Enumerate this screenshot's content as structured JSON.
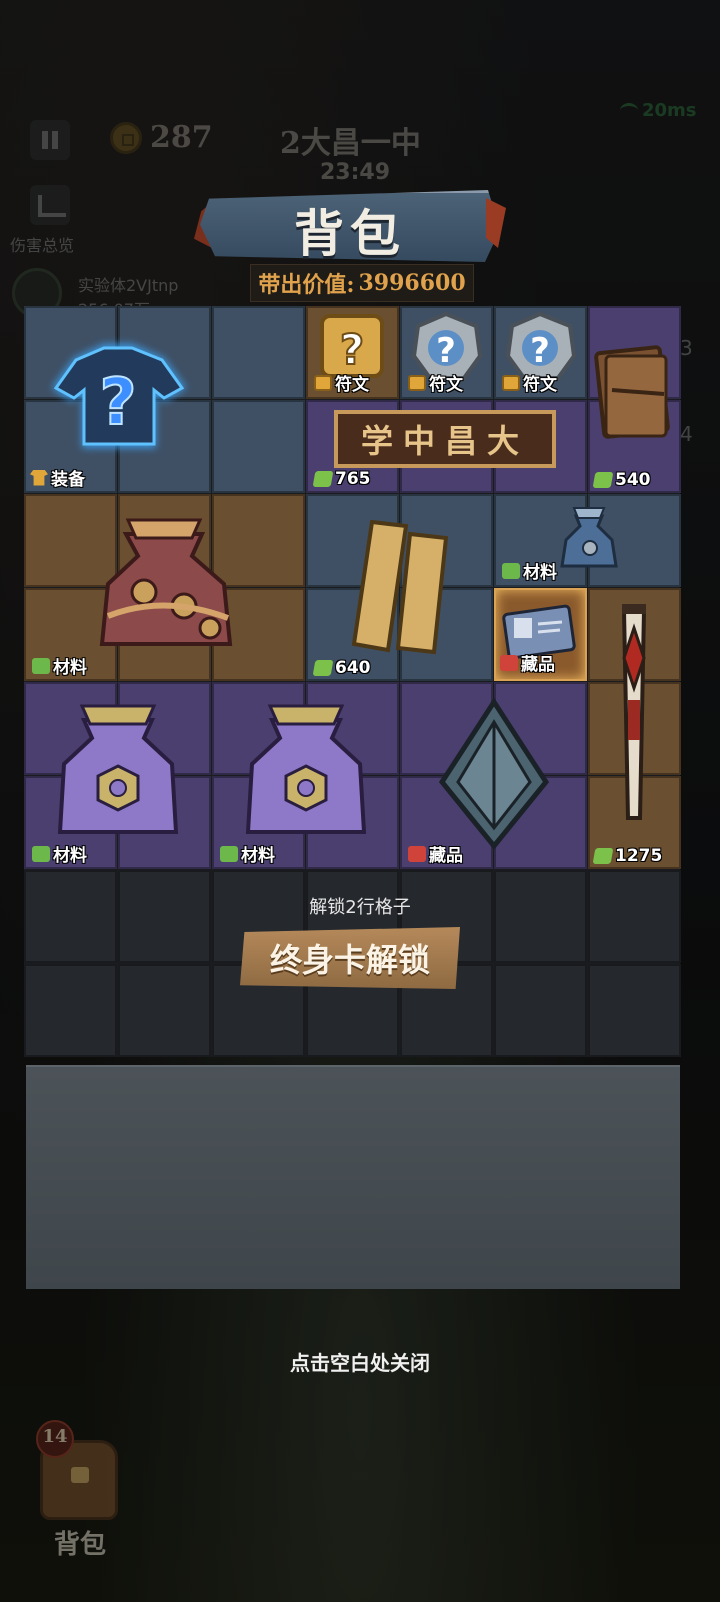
{
  "hud": {
    "coins": "287",
    "room_title": "2大昌一中",
    "timer": "23:49",
    "ping": "20ms",
    "damage_label": "伤害总览",
    "player_name": "实验体2VJtnp",
    "player_score": "256.07万",
    "side_numbers": [
      "3",
      "4"
    ]
  },
  "panel": {
    "title": "背包",
    "carry_label": "带出价值:",
    "carry_value": "3996600"
  },
  "items": [
    {
      "name": "mystery-shirt",
      "tag": "装备",
      "icon": "equip-icon"
    },
    {
      "name": "rune-gold",
      "tag": "符文",
      "icon": "coin-icon"
    },
    {
      "name": "rune-silver-1",
      "tag": "符文",
      "icon": "coin-icon"
    },
    {
      "name": "rune-silver-2",
      "tag": "符文",
      "icon": "coin-icon"
    },
    {
      "name": "school-plaque",
      "tag": "765",
      "icon": "money-icon",
      "text": "学中昌大"
    },
    {
      "name": "leather-book",
      "tag": "540",
      "icon": "money-icon"
    },
    {
      "name": "coin-pouch-red",
      "tag": "材料",
      "icon": "material-icon"
    },
    {
      "name": "gold-bars",
      "tag": "640",
      "icon": "money-icon"
    },
    {
      "name": "small-blue-pouch",
      "tag": "材料",
      "icon": "material-icon"
    },
    {
      "name": "id-badge",
      "tag": "藏品",
      "icon": "collection-icon"
    },
    {
      "name": "bat-club",
      "tag": "1275",
      "icon": "money-icon"
    },
    {
      "name": "purple-pouch-1",
      "tag": "材料",
      "icon": "material-icon"
    },
    {
      "name": "purple-pouch-2",
      "tag": "材料",
      "icon": "material-icon"
    },
    {
      "name": "spike-shield",
      "tag": "藏品",
      "icon": "collection-icon"
    }
  ],
  "unlock": {
    "text": "解锁2行格子",
    "button": "终身卡解锁"
  },
  "close_hint": "点击空白处关闭",
  "backpack": {
    "count": "14",
    "label": "背包"
  }
}
